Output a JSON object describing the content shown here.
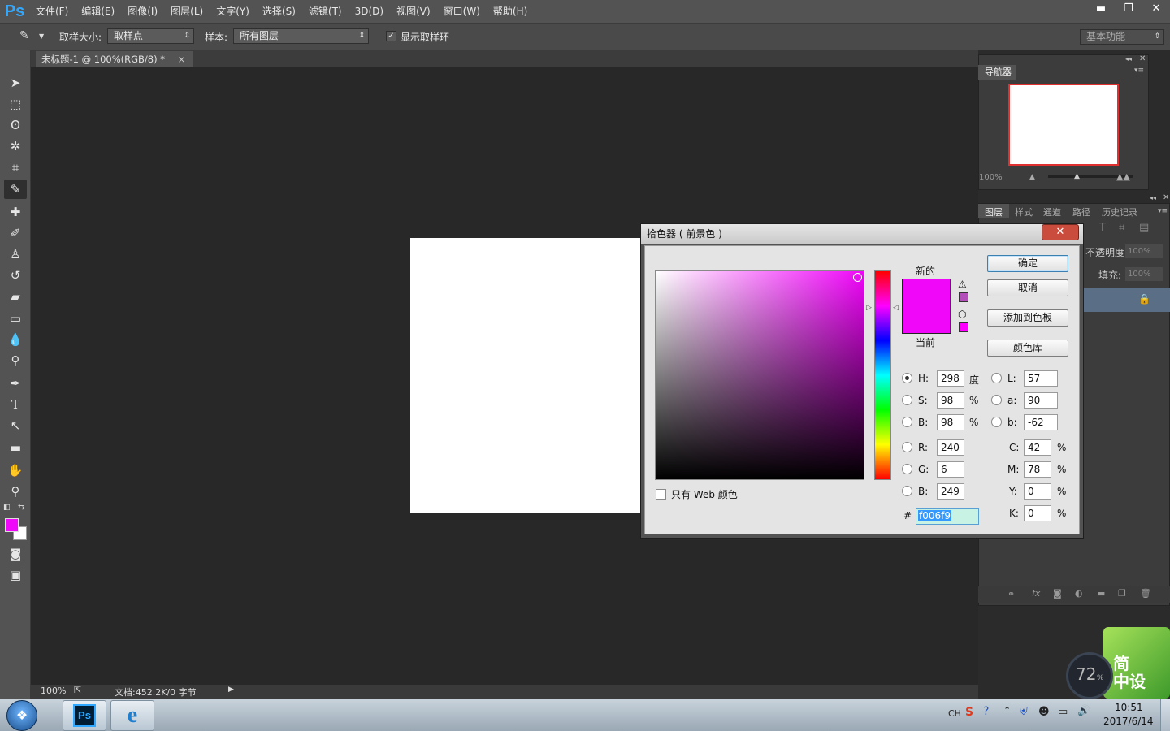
{
  "app": {
    "logo": "Ps",
    "menu": [
      "文件(F)",
      "编辑(E)",
      "图像(I)",
      "图层(L)",
      "文字(Y)",
      "选择(S)",
      "滤镜(T)",
      "3D(D)",
      "视图(V)",
      "窗口(W)",
      "帮助(H)"
    ],
    "window_controls": {
      "minimize": "▬",
      "restore": "❐",
      "close": "✕"
    }
  },
  "options": {
    "sample_size_label": "取样大小:",
    "sample_size_value": "取样点",
    "sample_label": "样本:",
    "sample_value": "所有图层",
    "show_ring_label": "显示取样环",
    "show_ring_checked": true,
    "workspace": "基本功能"
  },
  "document": {
    "tab_title": "未标题-1 @ 100%(RGB/8) *",
    "tab_close": "×",
    "zoom": "100%",
    "doc_info": "文档:452.2K/0 字节"
  },
  "tools": {
    "foreground_color": "#f006f9",
    "background_color": "#ffffff",
    "icons": [
      "move-icon",
      "marquee-icon",
      "lasso-icon",
      "magic-wand-icon",
      "crop-icon",
      "eyedropper-icon",
      "healing-brush-icon",
      "brush-icon",
      "stamp-icon",
      "history-brush-icon",
      "eraser-icon",
      "gradient-icon",
      "blur-icon",
      "dodge-icon",
      "pen-icon",
      "type-icon",
      "path-select-icon",
      "shape-icon",
      "hand-icon",
      "zoom-icon"
    ]
  },
  "navigator": {
    "title": "导航器",
    "zoom": "100%"
  },
  "layers_panel": {
    "tabs": [
      "图层",
      "样式",
      "通道",
      "路径",
      "历史记录"
    ],
    "active_tab": "图层",
    "opacity_label": "不透明度:",
    "opacity_value": "100%",
    "fill_label": "填充:",
    "fill_value": "100%"
  },
  "color_picker": {
    "title": "拾色器 ( 前景色 )",
    "close": "✕",
    "new_label": "新的",
    "current_label": "当前",
    "new_color": "#f006f9",
    "current_color": "#f006f9",
    "buttons": {
      "ok": "确定",
      "cancel": "取消",
      "add_swatch": "添加到色板",
      "libraries": "颜色库"
    },
    "hsb": [
      {
        "label": "H:",
        "value": "298",
        "unit": "度",
        "selected": true
      },
      {
        "label": "S:",
        "value": "98",
        "unit": "%",
        "selected": false
      },
      {
        "label": "B:",
        "value": "98",
        "unit": "%",
        "selected": false
      }
    ],
    "lab": [
      {
        "label": "L:",
        "value": "57"
      },
      {
        "label": "a:",
        "value": "90"
      },
      {
        "label": "b:",
        "value": "-62"
      }
    ],
    "rgb": [
      {
        "label": "R:",
        "value": "240"
      },
      {
        "label": "G:",
        "value": "6"
      },
      {
        "label": "B:",
        "value": "249"
      }
    ],
    "cmyk": [
      {
        "label": "C:",
        "value": "42",
        "unit": "%"
      },
      {
        "label": "M:",
        "value": "78",
        "unit": "%"
      },
      {
        "label": "Y:",
        "value": "0",
        "unit": "%"
      },
      {
        "label": "K:",
        "value": "0",
        "unit": "%"
      }
    ],
    "web_only_label": "只有 Web 颜色",
    "hex_symbol": "#",
    "hex": "f006f9"
  },
  "widgets": {
    "meter_value": "72",
    "meter_unit": "%",
    "leaf_text_1": "简",
    "leaf_text_2": "中设"
  },
  "taskbar": {
    "lang": "CH",
    "time": "10:51",
    "date": "2017/6/14",
    "ps_label": "Ps",
    "ie_label": "e"
  }
}
